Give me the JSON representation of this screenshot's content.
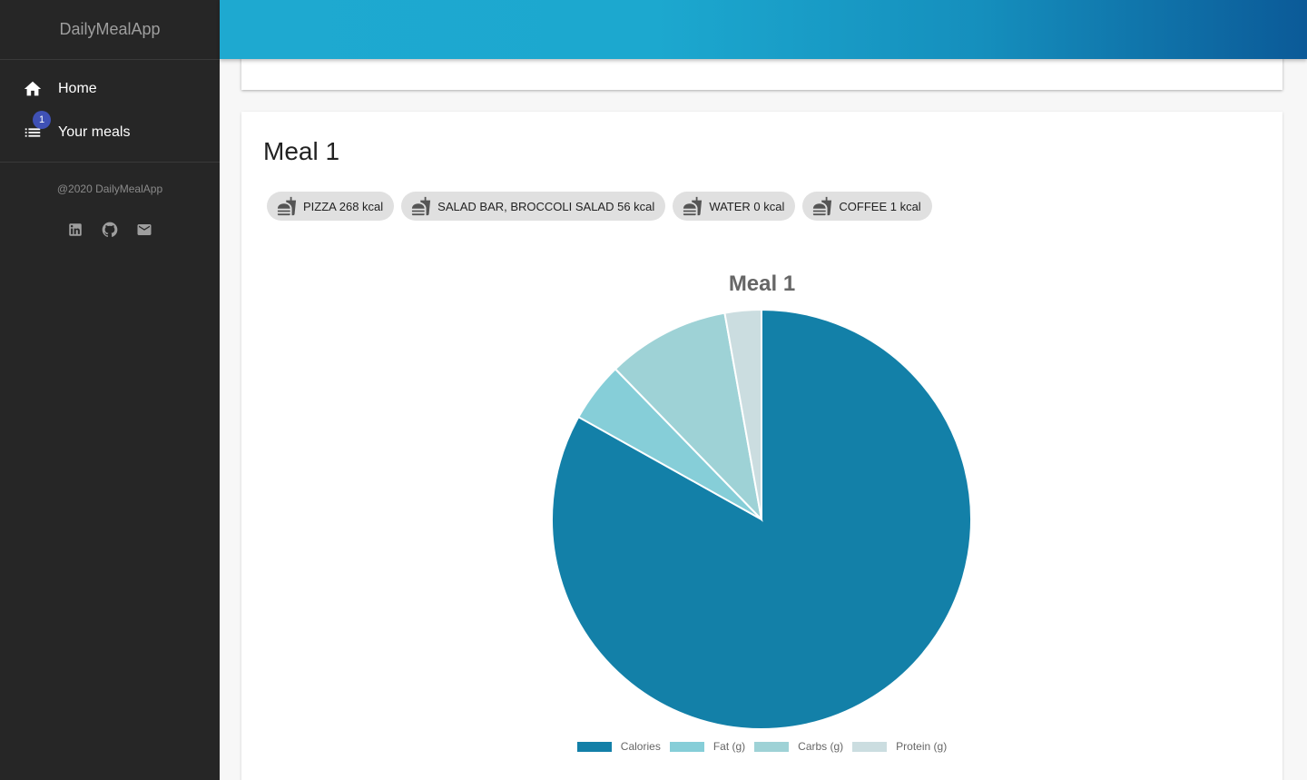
{
  "app": {
    "brand": "DailyMealApp"
  },
  "sidebar": {
    "items": [
      {
        "label": "Home",
        "icon": "home-icon"
      },
      {
        "label": "Your meals",
        "icon": "list-icon",
        "badge": "1"
      }
    ],
    "copyright": "@2020 DailyMealApp",
    "socials": [
      "linkedin-icon",
      "github-icon",
      "mail-icon"
    ]
  },
  "meal": {
    "title": "Meal 1",
    "chips": [
      {
        "label": "PIZZA 268 kcal"
      },
      {
        "label": "SALAD BAR, BROCCOLI SALAD 56 kcal"
      },
      {
        "label": "WATER 0 kcal"
      },
      {
        "label": "COFFEE 1 kcal"
      }
    ]
  },
  "colors": {
    "calories": "#1380a8",
    "fat": "#86ced8",
    "carbs": "#9ed2d6",
    "protein": "#cbdde0",
    "header_start": "#1ea9d0",
    "header_end": "#0b5a98",
    "badge": "#3f51b5"
  },
  "chart_data": {
    "type": "pie",
    "title": "Meal 1",
    "categories": [
      "Calories",
      "Fat (g)",
      "Carbs (g)",
      "Protein (g)"
    ],
    "values": [
      325,
      18,
      37,
      11
    ],
    "legend_position": "bottom"
  }
}
